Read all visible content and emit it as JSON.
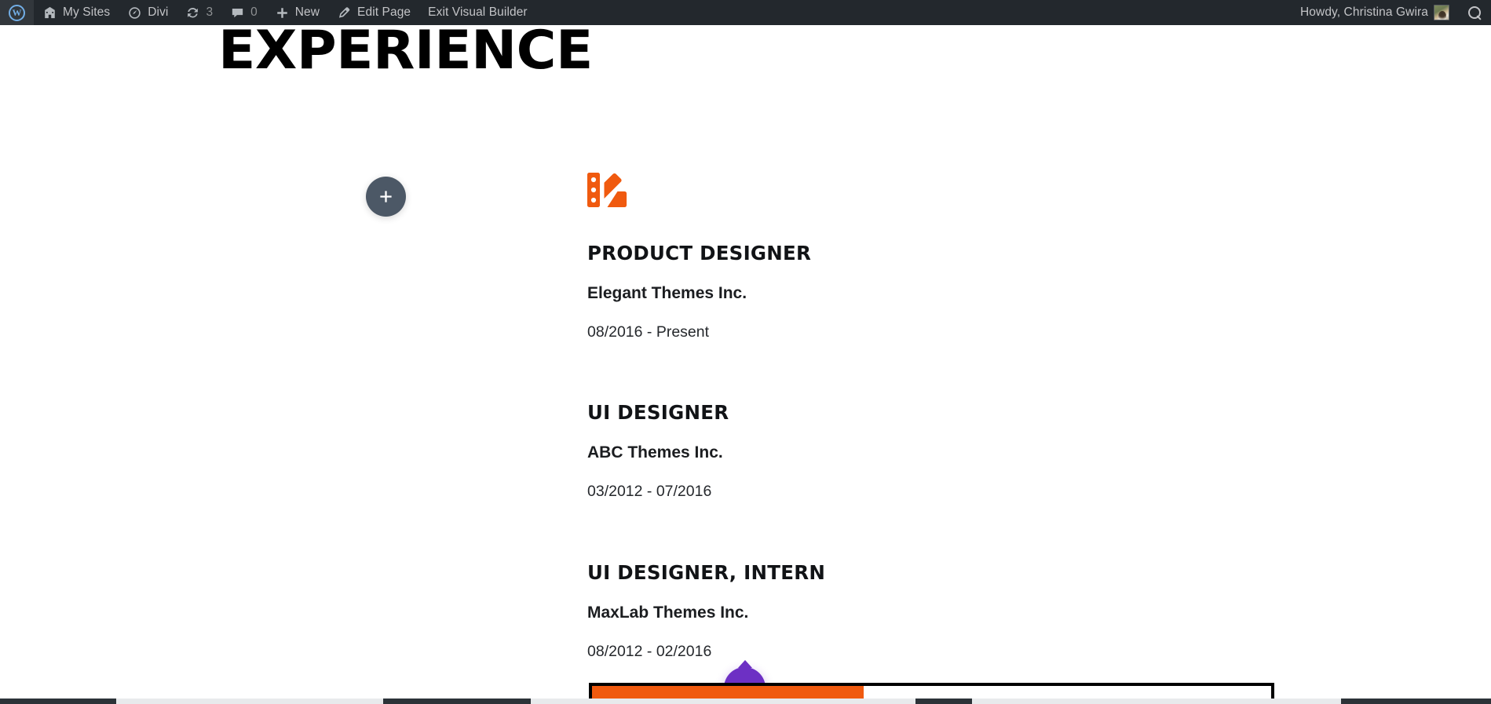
{
  "adminbar": {
    "wp_logo_label": "",
    "items": [
      {
        "icon": "wordpress-logo-icon",
        "label": ""
      },
      {
        "icon": "multisite-icon",
        "label": "My Sites"
      },
      {
        "icon": "divi-icon",
        "label": "Divi"
      },
      {
        "icon": "updates-icon",
        "label": "3"
      },
      {
        "icon": "comments-icon",
        "label": "0"
      },
      {
        "icon": "plus-icon",
        "label": "New"
      },
      {
        "icon": "pencil-icon",
        "label": "Edit Page"
      },
      {
        "icon": "",
        "label": "Exit Visual Builder"
      }
    ],
    "my_sites": "My Sites",
    "divi": "Divi",
    "updates_count": "3",
    "comments_count": "0",
    "new": "New",
    "edit_page": "Edit Page",
    "exit_visual_builder": "Exit Visual Builder",
    "howdy": "Howdy, Christina Gwira",
    "search_label": "Search"
  },
  "page": {
    "section_heading": "EXPERIENCE",
    "palette_icon": "color-swatches-icon",
    "accent_orange": "#F05A0F",
    "add_button_color": "#4C5866",
    "settings_button_color": "#6D30C4"
  },
  "entries": [
    {
      "role": "PRODUCT DESIGNER",
      "company": "Elegant Themes Inc.",
      "period": "08/2016 - Present"
    },
    {
      "role": "UI DESIGNER",
      "company": "ABC Themes Inc.",
      "period": "03/2012 - 07/2016"
    },
    {
      "role": "UI DESIGNER, INTERN",
      "company": "MaxLab Themes Inc.",
      "period": "08/2012 - 02/2016"
    }
  ],
  "bottom_bar": {
    "fill_color": "#F05A0F",
    "border_color": "#000000"
  }
}
